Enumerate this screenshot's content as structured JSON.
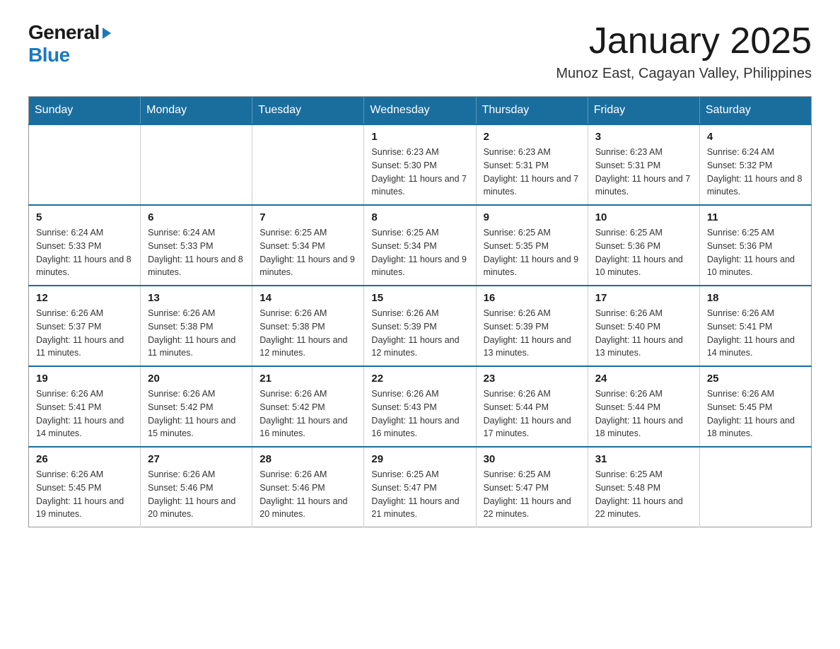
{
  "logo": {
    "general": "General",
    "blue": "Blue"
  },
  "title": "January 2025",
  "location": "Munoz East, Cagayan Valley, Philippines",
  "days_of_week": [
    "Sunday",
    "Monday",
    "Tuesday",
    "Wednesday",
    "Thursday",
    "Friday",
    "Saturday"
  ],
  "weeks": [
    [
      {
        "day": "",
        "info": ""
      },
      {
        "day": "",
        "info": ""
      },
      {
        "day": "",
        "info": ""
      },
      {
        "day": "1",
        "info": "Sunrise: 6:23 AM\nSunset: 5:30 PM\nDaylight: 11 hours and 7 minutes."
      },
      {
        "day": "2",
        "info": "Sunrise: 6:23 AM\nSunset: 5:31 PM\nDaylight: 11 hours and 7 minutes."
      },
      {
        "day": "3",
        "info": "Sunrise: 6:23 AM\nSunset: 5:31 PM\nDaylight: 11 hours and 7 minutes."
      },
      {
        "day": "4",
        "info": "Sunrise: 6:24 AM\nSunset: 5:32 PM\nDaylight: 11 hours and 8 minutes."
      }
    ],
    [
      {
        "day": "5",
        "info": "Sunrise: 6:24 AM\nSunset: 5:33 PM\nDaylight: 11 hours and 8 minutes."
      },
      {
        "day": "6",
        "info": "Sunrise: 6:24 AM\nSunset: 5:33 PM\nDaylight: 11 hours and 8 minutes."
      },
      {
        "day": "7",
        "info": "Sunrise: 6:25 AM\nSunset: 5:34 PM\nDaylight: 11 hours and 9 minutes."
      },
      {
        "day": "8",
        "info": "Sunrise: 6:25 AM\nSunset: 5:34 PM\nDaylight: 11 hours and 9 minutes."
      },
      {
        "day": "9",
        "info": "Sunrise: 6:25 AM\nSunset: 5:35 PM\nDaylight: 11 hours and 9 minutes."
      },
      {
        "day": "10",
        "info": "Sunrise: 6:25 AM\nSunset: 5:36 PM\nDaylight: 11 hours and 10 minutes."
      },
      {
        "day": "11",
        "info": "Sunrise: 6:25 AM\nSunset: 5:36 PM\nDaylight: 11 hours and 10 minutes."
      }
    ],
    [
      {
        "day": "12",
        "info": "Sunrise: 6:26 AM\nSunset: 5:37 PM\nDaylight: 11 hours and 11 minutes."
      },
      {
        "day": "13",
        "info": "Sunrise: 6:26 AM\nSunset: 5:38 PM\nDaylight: 11 hours and 11 minutes."
      },
      {
        "day": "14",
        "info": "Sunrise: 6:26 AM\nSunset: 5:38 PM\nDaylight: 11 hours and 12 minutes."
      },
      {
        "day": "15",
        "info": "Sunrise: 6:26 AM\nSunset: 5:39 PM\nDaylight: 11 hours and 12 minutes."
      },
      {
        "day": "16",
        "info": "Sunrise: 6:26 AM\nSunset: 5:39 PM\nDaylight: 11 hours and 13 minutes."
      },
      {
        "day": "17",
        "info": "Sunrise: 6:26 AM\nSunset: 5:40 PM\nDaylight: 11 hours and 13 minutes."
      },
      {
        "day": "18",
        "info": "Sunrise: 6:26 AM\nSunset: 5:41 PM\nDaylight: 11 hours and 14 minutes."
      }
    ],
    [
      {
        "day": "19",
        "info": "Sunrise: 6:26 AM\nSunset: 5:41 PM\nDaylight: 11 hours and 14 minutes."
      },
      {
        "day": "20",
        "info": "Sunrise: 6:26 AM\nSunset: 5:42 PM\nDaylight: 11 hours and 15 minutes."
      },
      {
        "day": "21",
        "info": "Sunrise: 6:26 AM\nSunset: 5:42 PM\nDaylight: 11 hours and 16 minutes."
      },
      {
        "day": "22",
        "info": "Sunrise: 6:26 AM\nSunset: 5:43 PM\nDaylight: 11 hours and 16 minutes."
      },
      {
        "day": "23",
        "info": "Sunrise: 6:26 AM\nSunset: 5:44 PM\nDaylight: 11 hours and 17 minutes."
      },
      {
        "day": "24",
        "info": "Sunrise: 6:26 AM\nSunset: 5:44 PM\nDaylight: 11 hours and 18 minutes."
      },
      {
        "day": "25",
        "info": "Sunrise: 6:26 AM\nSunset: 5:45 PM\nDaylight: 11 hours and 18 minutes."
      }
    ],
    [
      {
        "day": "26",
        "info": "Sunrise: 6:26 AM\nSunset: 5:45 PM\nDaylight: 11 hours and 19 minutes."
      },
      {
        "day": "27",
        "info": "Sunrise: 6:26 AM\nSunset: 5:46 PM\nDaylight: 11 hours and 20 minutes."
      },
      {
        "day": "28",
        "info": "Sunrise: 6:26 AM\nSunset: 5:46 PM\nDaylight: 11 hours and 20 minutes."
      },
      {
        "day": "29",
        "info": "Sunrise: 6:25 AM\nSunset: 5:47 PM\nDaylight: 11 hours and 21 minutes."
      },
      {
        "day": "30",
        "info": "Sunrise: 6:25 AM\nSunset: 5:47 PM\nDaylight: 11 hours and 22 minutes."
      },
      {
        "day": "31",
        "info": "Sunrise: 6:25 AM\nSunset: 5:48 PM\nDaylight: 11 hours and 22 minutes."
      },
      {
        "day": "",
        "info": ""
      }
    ]
  ]
}
